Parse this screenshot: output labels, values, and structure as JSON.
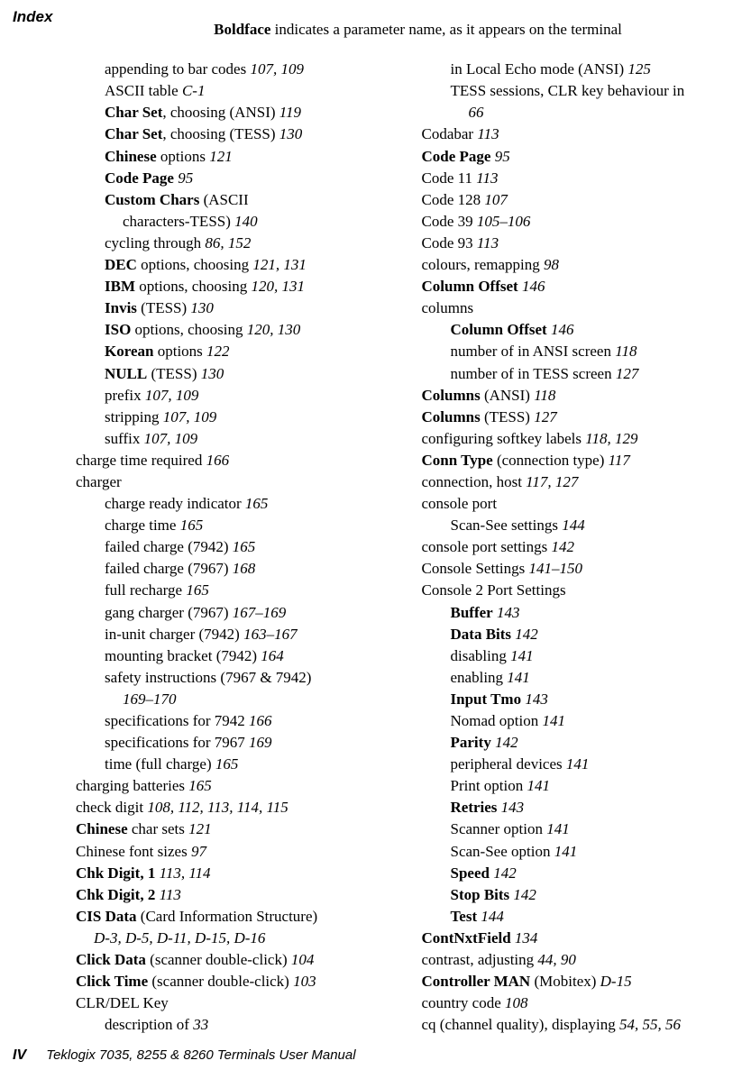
{
  "header": {
    "index_label": "Index",
    "boldface_bold": "Boldface",
    "boldface_rest": " indicates a parameter name, as it appears on the terminal"
  },
  "left": [
    {
      "lvl": 2,
      "parts": [
        {
          "t": "appending to bar codes   "
        },
        {
          "t": "107, 109",
          "i": true
        }
      ]
    },
    {
      "lvl": 2,
      "parts": [
        {
          "t": "ASCII table   "
        },
        {
          "t": "C-1",
          "i": true
        }
      ]
    },
    {
      "lvl": 2,
      "parts": [
        {
          "t": "Char Set",
          "b": true
        },
        {
          "t": ", choosing (ANSI)   "
        },
        {
          "t": "119",
          "i": true
        }
      ]
    },
    {
      "lvl": 2,
      "parts": [
        {
          "t": "Char Set",
          "b": true
        },
        {
          "t": ", choosing (TESS)   "
        },
        {
          "t": "130",
          "i": true
        }
      ]
    },
    {
      "lvl": 2,
      "parts": [
        {
          "t": "Chinese",
          "b": true
        },
        {
          "t": " options   "
        },
        {
          "t": "121",
          "i": true
        }
      ]
    },
    {
      "lvl": 2,
      "parts": [
        {
          "t": "Code Page",
          "b": true
        },
        {
          "t": "   "
        },
        {
          "t": "95",
          "i": true
        }
      ]
    },
    {
      "lvl": 2,
      "parts": [
        {
          "t": "Custom Chars",
          "b": true
        },
        {
          "t": " (ASCII"
        }
      ]
    },
    {
      "lvl": "cont",
      "parts": [
        {
          "t": "characters-TESS)   "
        },
        {
          "t": "140",
          "i": true
        }
      ]
    },
    {
      "lvl": 2,
      "parts": [
        {
          "t": "cycling through   "
        },
        {
          "t": "86, 152",
          "i": true
        }
      ]
    },
    {
      "lvl": 2,
      "parts": [
        {
          "t": "DEC",
          "b": true
        },
        {
          "t": " options, choosing   "
        },
        {
          "t": "121, 131",
          "i": true
        }
      ]
    },
    {
      "lvl": 2,
      "parts": [
        {
          "t": "IBM",
          "b": true
        },
        {
          "t": " options, choosing   "
        },
        {
          "t": "120, 131",
          "i": true
        }
      ]
    },
    {
      "lvl": 2,
      "parts": [
        {
          "t": "Invis",
          "b": true
        },
        {
          "t": " (TESS)   "
        },
        {
          "t": "130",
          "i": true
        }
      ]
    },
    {
      "lvl": 2,
      "parts": [
        {
          "t": "ISO",
          "b": true
        },
        {
          "t": " options, choosing   "
        },
        {
          "t": "120, 130",
          "i": true
        }
      ]
    },
    {
      "lvl": 2,
      "parts": [
        {
          "t": "Korean",
          "b": true
        },
        {
          "t": " options   "
        },
        {
          "t": "122",
          "i": true
        }
      ]
    },
    {
      "lvl": 2,
      "parts": [
        {
          "t": "NULL",
          "b": true
        },
        {
          "t": " (TESS)   "
        },
        {
          "t": "130",
          "i": true
        }
      ]
    },
    {
      "lvl": 2,
      "parts": [
        {
          "t": "prefix   "
        },
        {
          "t": "107, 109",
          "i": true
        }
      ]
    },
    {
      "lvl": 2,
      "parts": [
        {
          "t": "stripping   "
        },
        {
          "t": "107, 109",
          "i": true
        }
      ]
    },
    {
      "lvl": 2,
      "parts": [
        {
          "t": "suffix   "
        },
        {
          "t": "107, 109",
          "i": true
        }
      ]
    },
    {
      "lvl": 1,
      "parts": [
        {
          "t": "charge time required   "
        },
        {
          "t": "166",
          "i": true
        }
      ]
    },
    {
      "lvl": 1,
      "parts": [
        {
          "t": "charger"
        }
      ]
    },
    {
      "lvl": 2,
      "parts": [
        {
          "t": "charge ready indicator   "
        },
        {
          "t": "165",
          "i": true
        }
      ]
    },
    {
      "lvl": 2,
      "parts": [
        {
          "t": "charge time   "
        },
        {
          "t": "165",
          "i": true
        }
      ]
    },
    {
      "lvl": 2,
      "parts": [
        {
          "t": "failed charge (7942)   "
        },
        {
          "t": "165",
          "i": true
        }
      ]
    },
    {
      "lvl": 2,
      "parts": [
        {
          "t": "failed charge (7967)   "
        },
        {
          "t": "168",
          "i": true
        }
      ]
    },
    {
      "lvl": 2,
      "parts": [
        {
          "t": "full recharge   "
        },
        {
          "t": "165",
          "i": true
        }
      ]
    },
    {
      "lvl": 2,
      "parts": [
        {
          "t": "gang charger (7967)   "
        },
        {
          "t": "167–169",
          "i": true
        }
      ]
    },
    {
      "lvl": 2,
      "parts": [
        {
          "t": "in-unit charger (7942)   "
        },
        {
          "t": "163–167",
          "i": true
        }
      ]
    },
    {
      "lvl": 2,
      "parts": [
        {
          "t": "mounting bracket (7942)   "
        },
        {
          "t": "164",
          "i": true
        }
      ]
    },
    {
      "lvl": 2,
      "parts": [
        {
          "t": "safety instructions (7967 & 7942)   "
        }
      ]
    },
    {
      "lvl": "cont",
      "parts": [
        {
          "t": "169–170",
          "i": true
        }
      ]
    },
    {
      "lvl": 2,
      "parts": [
        {
          "t": "specifications for 7942   "
        },
        {
          "t": "166",
          "i": true
        }
      ]
    },
    {
      "lvl": 2,
      "parts": [
        {
          "t": "specifications for 7967   "
        },
        {
          "t": "169",
          "i": true
        }
      ]
    },
    {
      "lvl": 2,
      "parts": [
        {
          "t": "time (full charge)   "
        },
        {
          "t": "165",
          "i": true
        }
      ]
    },
    {
      "lvl": 1,
      "parts": [
        {
          "t": "charging batteries   "
        },
        {
          "t": "165",
          "i": true
        }
      ]
    },
    {
      "lvl": 1,
      "parts": [
        {
          "t": "check digit   "
        },
        {
          "t": "108, 112, 113, 114, 115",
          "i": true
        }
      ]
    },
    {
      "lvl": 1,
      "parts": [
        {
          "t": "Chinese",
          "b": true
        },
        {
          "t": "  char sets   "
        },
        {
          "t": "121",
          "i": true
        }
      ]
    },
    {
      "lvl": 1,
      "parts": [
        {
          "t": "Chinese font sizes   "
        },
        {
          "t": "97",
          "i": true
        }
      ]
    },
    {
      "lvl": 1,
      "parts": [
        {
          "t": "Chk Digit, 1",
          "b": true
        },
        {
          "t": "   "
        },
        {
          "t": "113, 114",
          "i": true
        }
      ]
    },
    {
      "lvl": 1,
      "parts": [
        {
          "t": "Chk Digit, 2",
          "b": true
        },
        {
          "t": "   "
        },
        {
          "t": "113",
          "i": true
        }
      ]
    },
    {
      "lvl": 1,
      "parts": [
        {
          "t": "CIS Data",
          "b": true
        },
        {
          "t": " (Card Information Structure)   "
        }
      ]
    },
    {
      "lvl": "cont2",
      "parts": [
        {
          "t": "D-3, D-5, D-11, D-15, D-16",
          "i": true
        }
      ]
    },
    {
      "lvl": 1,
      "parts": [
        {
          "t": "Click Data",
          "b": true
        },
        {
          "t": " (scanner double-click)   "
        },
        {
          "t": "104",
          "i": true
        }
      ]
    },
    {
      "lvl": 1,
      "parts": [
        {
          "t": "Click Time",
          "b": true
        },
        {
          "t": " (scanner double-click)   "
        },
        {
          "t": "103",
          "i": true
        }
      ]
    },
    {
      "lvl": 1,
      "parts": [
        {
          "t": "CLR/DEL Key"
        }
      ]
    },
    {
      "lvl": 2,
      "parts": [
        {
          "t": "description of   "
        },
        {
          "t": "33",
          "i": true
        }
      ]
    }
  ],
  "right": [
    {
      "lvl": 2,
      "parts": [
        {
          "t": "in Local Echo mode (ANSI)   "
        },
        {
          "t": "125",
          "i": true
        }
      ]
    },
    {
      "lvl": 2,
      "parts": [
        {
          "t": "TESS sessions, CLR key behaviour in   "
        }
      ]
    },
    {
      "lvl": "cont",
      "parts": [
        {
          "t": "66",
          "i": true
        }
      ]
    },
    {
      "lvl": 1,
      "parts": [
        {
          "t": "Codabar   "
        },
        {
          "t": "113",
          "i": true
        }
      ]
    },
    {
      "lvl": 1,
      "parts": [
        {
          "t": "Code Page",
          "b": true
        },
        {
          "t": "   "
        },
        {
          "t": "95",
          "i": true
        }
      ]
    },
    {
      "lvl": 1,
      "parts": [
        {
          "t": "Code 11   "
        },
        {
          "t": "113",
          "i": true
        }
      ]
    },
    {
      "lvl": 1,
      "parts": [
        {
          "t": "Code 128   "
        },
        {
          "t": "107",
          "i": true
        }
      ]
    },
    {
      "lvl": 1,
      "parts": [
        {
          "t": "Code 39   "
        },
        {
          "t": "105–106",
          "i": true
        }
      ]
    },
    {
      "lvl": 1,
      "parts": [
        {
          "t": "Code 93   "
        },
        {
          "t": "113",
          "i": true
        }
      ]
    },
    {
      "lvl": 1,
      "parts": [
        {
          "t": "colours, remapping   "
        },
        {
          "t": "98",
          "i": true
        }
      ]
    },
    {
      "lvl": 1,
      "parts": [
        {
          "t": "Column Offset",
          "b": true
        },
        {
          "t": "   "
        },
        {
          "t": "146",
          "i": true
        }
      ]
    },
    {
      "lvl": 1,
      "parts": [
        {
          "t": "columns"
        }
      ]
    },
    {
      "lvl": 2,
      "parts": [
        {
          "t": "Column Offset",
          "b": true
        },
        {
          "t": "   "
        },
        {
          "t": "146",
          "i": true
        }
      ]
    },
    {
      "lvl": 2,
      "parts": [
        {
          "t": "number of in ANSI screen   "
        },
        {
          "t": "118",
          "i": true
        }
      ]
    },
    {
      "lvl": 2,
      "parts": [
        {
          "t": "number of in TESS screen   "
        },
        {
          "t": "127",
          "i": true
        }
      ]
    },
    {
      "lvl": 1,
      "parts": [
        {
          "t": "Columns",
          "b": true
        },
        {
          "t": " (ANSI)   "
        },
        {
          "t": "118",
          "i": true
        }
      ]
    },
    {
      "lvl": 1,
      "parts": [
        {
          "t": "Columns",
          "b": true
        },
        {
          "t": " (TESS)   "
        },
        {
          "t": "127",
          "i": true
        }
      ]
    },
    {
      "lvl": 1,
      "parts": [
        {
          "t": "configuring softkey labels   "
        },
        {
          "t": "118, 129",
          "i": true
        }
      ]
    },
    {
      "lvl": 1,
      "parts": [
        {
          "t": "Conn Type",
          "b": true
        },
        {
          "t": " (connection type)   "
        },
        {
          "t": "117",
          "i": true
        }
      ]
    },
    {
      "lvl": 1,
      "parts": [
        {
          "t": "connection, host   "
        },
        {
          "t": "117, 127",
          "i": true
        }
      ]
    },
    {
      "lvl": 1,
      "parts": [
        {
          "t": "console port"
        }
      ]
    },
    {
      "lvl": 2,
      "parts": [
        {
          "t": "Scan-See settings   "
        },
        {
          "t": "144",
          "i": true
        }
      ]
    },
    {
      "lvl": 1,
      "parts": [
        {
          "t": "console port settings   "
        },
        {
          "t": "142",
          "i": true
        }
      ]
    },
    {
      "lvl": 1,
      "parts": [
        {
          "t": "Console Settings   "
        },
        {
          "t": "141–150",
          "i": true
        }
      ]
    },
    {
      "lvl": 1,
      "parts": [
        {
          "t": "Console 2 Port Settings"
        }
      ]
    },
    {
      "lvl": 2,
      "parts": [
        {
          "t": "Buffer",
          "b": true
        },
        {
          "t": "   "
        },
        {
          "t": "143",
          "i": true
        }
      ]
    },
    {
      "lvl": 2,
      "parts": [
        {
          "t": "Data Bits",
          "b": true
        },
        {
          "t": "   "
        },
        {
          "t": "142",
          "i": true
        }
      ]
    },
    {
      "lvl": 2,
      "parts": [
        {
          "t": "disabling   "
        },
        {
          "t": "141",
          "i": true
        }
      ]
    },
    {
      "lvl": 2,
      "parts": [
        {
          "t": "enabling   "
        },
        {
          "t": "141",
          "i": true
        }
      ]
    },
    {
      "lvl": 2,
      "parts": [
        {
          "t": "Input Tmo",
          "b": true
        },
        {
          "t": "   "
        },
        {
          "t": "143",
          "i": true
        }
      ]
    },
    {
      "lvl": 2,
      "parts": [
        {
          "t": "Nomad option   "
        },
        {
          "t": "141",
          "i": true
        }
      ]
    },
    {
      "lvl": 2,
      "parts": [
        {
          "t": "Parity",
          "b": true
        },
        {
          "t": "   "
        },
        {
          "t": "142",
          "i": true
        }
      ]
    },
    {
      "lvl": 2,
      "parts": [
        {
          "t": "peripheral devices   "
        },
        {
          "t": "141",
          "i": true
        }
      ]
    },
    {
      "lvl": 2,
      "parts": [
        {
          "t": "Print option   "
        },
        {
          "t": "141",
          "i": true
        }
      ]
    },
    {
      "lvl": 2,
      "parts": [
        {
          "t": "Retries",
          "b": true
        },
        {
          "t": "   "
        },
        {
          "t": "143",
          "i": true
        }
      ]
    },
    {
      "lvl": 2,
      "parts": [
        {
          "t": "Scanner option   "
        },
        {
          "t": "141",
          "i": true
        }
      ]
    },
    {
      "lvl": 2,
      "parts": [
        {
          "t": "Scan-See option   "
        },
        {
          "t": "141",
          "i": true
        }
      ]
    },
    {
      "lvl": 2,
      "parts": [
        {
          "t": "Speed",
          "b": true
        },
        {
          "t": "   "
        },
        {
          "t": "142",
          "i": true
        }
      ]
    },
    {
      "lvl": 2,
      "parts": [
        {
          "t": "Stop Bits",
          "b": true
        },
        {
          "t": "   "
        },
        {
          "t": "142",
          "i": true
        }
      ]
    },
    {
      "lvl": 2,
      "parts": [
        {
          "t": "Test",
          "b": true
        },
        {
          "t": "   "
        },
        {
          "t": "144",
          "i": true
        }
      ]
    },
    {
      "lvl": 1,
      "parts": [
        {
          "t": "ContNxtField",
          "b": true
        },
        {
          "t": "   "
        },
        {
          "t": "134",
          "i": true
        }
      ]
    },
    {
      "lvl": 1,
      "parts": [
        {
          "t": "contrast, adjusting   "
        },
        {
          "t": "44, 90",
          "i": true
        }
      ]
    },
    {
      "lvl": 1,
      "parts": [
        {
          "t": "Controller MAN",
          "b": true
        },
        {
          "t": "  (Mobitex)   "
        },
        {
          "t": "D-15",
          "i": true
        }
      ]
    },
    {
      "lvl": 1,
      "parts": [
        {
          "t": "country code   "
        },
        {
          "t": "108",
          "i": true
        }
      ]
    },
    {
      "lvl": 1,
      "parts": [
        {
          "t": "cq (channel quality), displaying   "
        },
        {
          "t": "54, 55, 56",
          "i": true
        }
      ]
    }
  ],
  "footer": {
    "page_num": "IV",
    "title": "Teklogix 7035, 8255 & 8260 Terminals User Manual"
  }
}
